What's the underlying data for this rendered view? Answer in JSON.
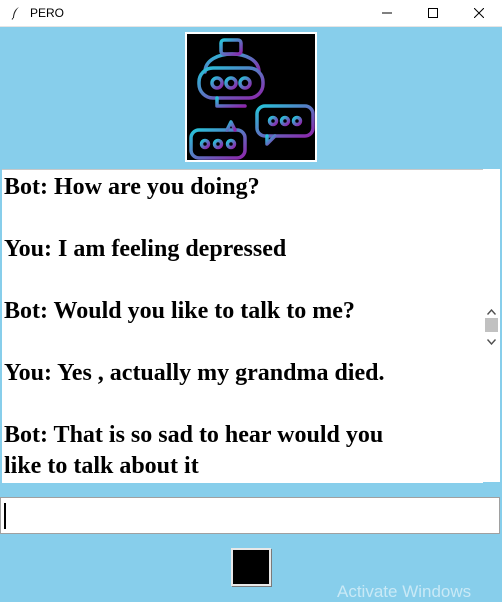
{
  "window": {
    "title": "PERO",
    "icons": {
      "app": "feather-icon",
      "minimize": "minimize-icon",
      "maximize": "maximize-icon",
      "close": "close-icon"
    }
  },
  "logo": {
    "icon": "robot-chat-icon",
    "colors": {
      "gradient_start": "#26c6da",
      "gradient_end": "#8e24aa",
      "background": "#000000"
    }
  },
  "chat": {
    "messages": [
      "Bot: How are you doing?",
      "You: I am feeling depressed",
      "Bot: Would you like to talk to me?",
      "You: Yes , actually my grandma died.",
      "Bot: That is so sad to hear would you\nlike to talk about it"
    ]
  },
  "input": {
    "value": ""
  },
  "send_button": {
    "label": ""
  },
  "watermark": {
    "text": "Activate Windows"
  },
  "colors": {
    "background": "#87ceeb",
    "chat_background": "#ffffff",
    "button": "#000000"
  }
}
